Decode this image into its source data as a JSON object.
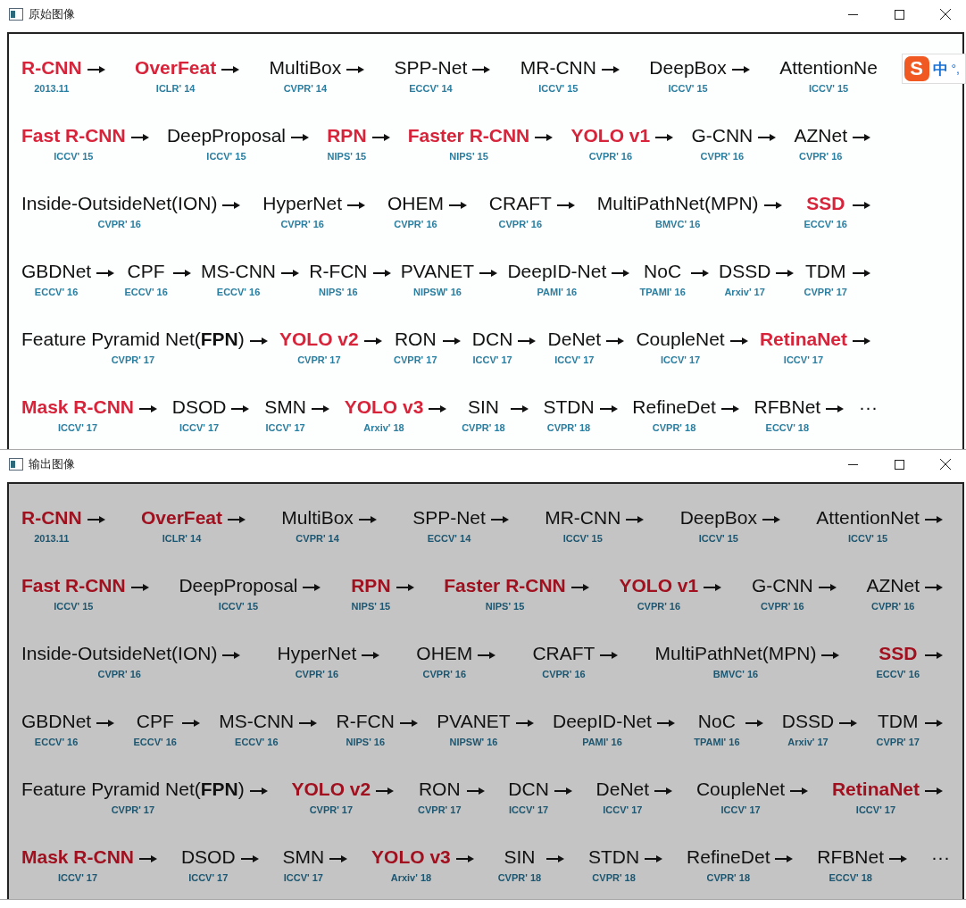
{
  "windows": [
    {
      "title": "原始图像",
      "filtered": false,
      "ime": {
        "logo": "S",
        "mode": "中",
        "punct": "°,"
      },
      "lines": [
        {
          "nodes": [
            {
              "name": "R-CNN",
              "venue": "2013.11",
              "red": true,
              "arrow": true
            },
            {
              "name": "OverFeat",
              "venue": "ICLR' 14",
              "red": true,
              "arrow": true
            },
            {
              "name": "MultiBox",
              "venue": "CVPR' 14",
              "red": false,
              "arrow": true
            },
            {
              "name": "SPP-Net",
              "venue": "ECCV' 14",
              "red": false,
              "arrow": true
            },
            {
              "name": "MR-CNN",
              "venue": "ICCV' 15",
              "red": false,
              "arrow": true
            },
            {
              "name": "DeepBox",
              "venue": "ICCV' 15",
              "red": false,
              "arrow": true
            },
            {
              "name": "AttentionNe",
              "venue": "ICCV' 15",
              "red": false,
              "arrow": false
            }
          ]
        },
        {
          "nodes": [
            {
              "name": "Fast R-CNN",
              "venue": "ICCV' 15",
              "red": true,
              "arrow": true
            },
            {
              "name": "DeepProposal",
              "venue": "ICCV' 15",
              "red": false,
              "arrow": true
            },
            {
              "name": "RPN",
              "venue": "NIPS' 15",
              "red": true,
              "arrow": true
            },
            {
              "name": "Faster R-CNN",
              "venue": "NIPS' 15",
              "red": true,
              "arrow": true
            },
            {
              "name": "YOLO v1",
              "venue": "CVPR' 16",
              "red": true,
              "arrow": true
            },
            {
              "name": "G-CNN",
              "venue": "CVPR' 16",
              "red": false,
              "arrow": true
            },
            {
              "name": "AZNet",
              "venue": "CVPR' 16",
              "red": false,
              "arrow": true
            }
          ]
        },
        {
          "nodes": [
            {
              "name": "Inside-OutsideNet(ION)",
              "venue": "CVPR' 16",
              "red": false,
              "arrow": true
            },
            {
              "name": "HyperNet",
              "venue": "CVPR' 16",
              "red": false,
              "arrow": true
            },
            {
              "name": "OHEM",
              "venue": "CVPR' 16",
              "red": false,
              "arrow": true
            },
            {
              "name": "CRAFT",
              "venue": "CVPR' 16",
              "red": false,
              "arrow": true
            },
            {
              "name": "MultiPathNet(MPN)",
              "venue": "BMVC' 16",
              "red": false,
              "arrow": true
            },
            {
              "name": "SSD",
              "venue": "ECCV' 16",
              "red": true,
              "arrow": true
            }
          ]
        },
        {
          "nodes": [
            {
              "name": "GBDNet",
              "venue": "ECCV' 16",
              "red": false,
              "arrow": true
            },
            {
              "name": "CPF",
              "venue": "ECCV' 16",
              "red": false,
              "arrow": true
            },
            {
              "name": "MS-CNN",
              "venue": "ECCV' 16",
              "red": false,
              "arrow": true
            },
            {
              "name": "R-FCN",
              "venue": "NIPS' 16",
              "red": false,
              "arrow": true
            },
            {
              "name": "PVANET",
              "venue": "NIPSW' 16",
              "red": false,
              "arrow": true
            },
            {
              "name": "DeepID-Net",
              "venue": "PAMI' 16",
              "red": false,
              "arrow": true
            },
            {
              "name": "NoC",
              "venue": "TPAMI' 16",
              "red": false,
              "arrow": true
            },
            {
              "name": "DSSD",
              "venue": "Arxiv' 17",
              "red": false,
              "arrow": true
            },
            {
              "name": "TDM",
              "venue": "CVPR' 17",
              "red": false,
              "arrow": true
            }
          ]
        },
        {
          "nodes": [
            {
              "name": "Feature Pyramid Net(**FPN**)",
              "venue": "CVPR' 17",
              "red": false,
              "arrow": true
            },
            {
              "name": "YOLO v2",
              "venue": "CVPR' 17",
              "red": true,
              "arrow": true
            },
            {
              "name": "RON",
              "venue": "CVPR' 17",
              "red": false,
              "arrow": true
            },
            {
              "name": "DCN",
              "venue": "ICCV' 17",
              "red": false,
              "arrow": true
            },
            {
              "name": "DeNet",
              "venue": "ICCV' 17",
              "red": false,
              "arrow": true
            },
            {
              "name": "CoupleNet",
              "venue": "ICCV' 17",
              "red": false,
              "arrow": true
            },
            {
              "name": "RetinaNet",
              "venue": "ICCV' 17",
              "red": true,
              "arrow": true
            }
          ]
        },
        {
          "nodes": [
            {
              "name": "Mask R-CNN",
              "venue": "ICCV' 17",
              "red": true,
              "arrow": true
            },
            {
              "name": "DSOD",
              "venue": "ICCV' 17",
              "red": false,
              "arrow": true
            },
            {
              "name": "SMN",
              "venue": "ICCV' 17",
              "red": false,
              "arrow": true
            },
            {
              "name": "YOLO v3",
              "venue": "Arxiv' 18",
              "red": true,
              "arrow": true
            },
            {
              "name": "SIN",
              "venue": "CVPR' 18",
              "red": false,
              "arrow": true
            },
            {
              "name": "STDN",
              "venue": "CVPR' 18",
              "red": false,
              "arrow": true
            },
            {
              "name": "RefineDet",
              "venue": "CVPR' 18",
              "red": false,
              "arrow": true
            },
            {
              "name": "RFBNet",
              "venue": "ECCV' 18",
              "red": false,
              "arrow": true
            },
            {
              "name": "···",
              "red": false,
              "arrow": false
            }
          ]
        }
      ]
    },
    {
      "title": "输出图像",
      "filtered": true,
      "lines": [
        {
          "nodes": [
            {
              "name": "R-CNN",
              "venue": "2013.11",
              "red": true,
              "arrow": true
            },
            {
              "name": "OverFeat",
              "venue": "ICLR' 14",
              "red": true,
              "arrow": true
            },
            {
              "name": "MultiBox",
              "venue": "CVPR' 14",
              "red": false,
              "arrow": true
            },
            {
              "name": "SPP-Net",
              "venue": "ECCV' 14",
              "red": false,
              "arrow": true
            },
            {
              "name": "MR-CNN",
              "venue": "ICCV' 15",
              "red": false,
              "arrow": true
            },
            {
              "name": "DeepBox",
              "venue": "ICCV' 15",
              "red": false,
              "arrow": true
            },
            {
              "name": "AttentionNet",
              "venue": "ICCV' 15",
              "red": false,
              "arrow": true
            }
          ]
        },
        {
          "nodes": [
            {
              "name": "Fast R-CNN",
              "venue": "ICCV' 15",
              "red": true,
              "arrow": true
            },
            {
              "name": "DeepProposal",
              "venue": "ICCV' 15",
              "red": false,
              "arrow": true
            },
            {
              "name": "RPN",
              "venue": "NIPS' 15",
              "red": true,
              "arrow": true
            },
            {
              "name": "Faster R-CNN",
              "venue": "NIPS' 15",
              "red": true,
              "arrow": true
            },
            {
              "name": "YOLO v1",
              "venue": "CVPR' 16",
              "red": true,
              "arrow": true
            },
            {
              "name": "G-CNN",
              "venue": "CVPR' 16",
              "red": false,
              "arrow": true
            },
            {
              "name": "AZNet",
              "venue": "CVPR' 16",
              "red": false,
              "arrow": true
            }
          ]
        },
        {
          "nodes": [
            {
              "name": "Inside-OutsideNet(ION)",
              "venue": "CVPR' 16",
              "red": false,
              "arrow": true
            },
            {
              "name": "HyperNet",
              "venue": "CVPR' 16",
              "red": false,
              "arrow": true
            },
            {
              "name": "OHEM",
              "venue": "CVPR' 16",
              "red": false,
              "arrow": true
            },
            {
              "name": "CRAFT",
              "venue": "CVPR' 16",
              "red": false,
              "arrow": true
            },
            {
              "name": "MultiPathNet(MPN)",
              "venue": "BMVC' 16",
              "red": false,
              "arrow": true
            },
            {
              "name": "SSD",
              "venue": "ECCV' 16",
              "red": true,
              "arrow": true
            }
          ]
        },
        {
          "nodes": [
            {
              "name": "GBDNet",
              "venue": "ECCV' 16",
              "red": false,
              "arrow": true
            },
            {
              "name": "CPF",
              "venue": "ECCV' 16",
              "red": false,
              "arrow": true
            },
            {
              "name": "MS-CNN",
              "venue": "ECCV' 16",
              "red": false,
              "arrow": true
            },
            {
              "name": "R-FCN",
              "venue": "NIPS' 16",
              "red": false,
              "arrow": true
            },
            {
              "name": "PVANET",
              "venue": "NIPSW' 16",
              "red": false,
              "arrow": true
            },
            {
              "name": "DeepID-Net",
              "venue": "PAMI' 16",
              "red": false,
              "arrow": true
            },
            {
              "name": "NoC",
              "venue": "TPAMI' 16",
              "red": false,
              "arrow": true
            },
            {
              "name": "DSSD",
              "venue": "Arxiv' 17",
              "red": false,
              "arrow": true
            },
            {
              "name": "TDM",
              "venue": "CVPR' 17",
              "red": false,
              "arrow": true
            }
          ]
        },
        {
          "nodes": [
            {
              "name": "Feature Pyramid Net(**FPN**)",
              "venue": "CVPR' 17",
              "red": false,
              "arrow": true
            },
            {
              "name": "YOLO v2",
              "venue": "CVPR' 17",
              "red": true,
              "arrow": true
            },
            {
              "name": "RON",
              "venue": "CVPR' 17",
              "red": false,
              "arrow": true
            },
            {
              "name": "DCN",
              "venue": "ICCV' 17",
              "red": false,
              "arrow": true
            },
            {
              "name": "DeNet",
              "venue": "ICCV' 17",
              "red": false,
              "arrow": true
            },
            {
              "name": "CoupleNet",
              "venue": "ICCV' 17",
              "red": false,
              "arrow": true
            },
            {
              "name": "RetinaNet",
              "venue": "ICCV' 17",
              "red": true,
              "arrow": true
            }
          ]
        },
        {
          "nodes": [
            {
              "name": "Mask R-CNN",
              "venue": "ICCV' 17",
              "red": true,
              "arrow": true
            },
            {
              "name": "DSOD",
              "venue": "ICCV' 17",
              "red": false,
              "arrow": true
            },
            {
              "name": "SMN",
              "venue": "ICCV' 17",
              "red": false,
              "arrow": true
            },
            {
              "name": "YOLO v3",
              "venue": "Arxiv' 18",
              "red": true,
              "arrow": true
            },
            {
              "name": "SIN",
              "venue": "CVPR' 18",
              "red": false,
              "arrow": true
            },
            {
              "name": "STDN",
              "venue": "CVPR' 18",
              "red": false,
              "arrow": true
            },
            {
              "name": "RefineDet",
              "venue": "CVPR' 18",
              "red": false,
              "arrow": true
            },
            {
              "name": "RFBNet",
              "venue": "ECCV' 18",
              "red": false,
              "arrow": true
            },
            {
              "name": "···",
              "red": false,
              "arrow": false
            }
          ]
        }
      ]
    }
  ]
}
